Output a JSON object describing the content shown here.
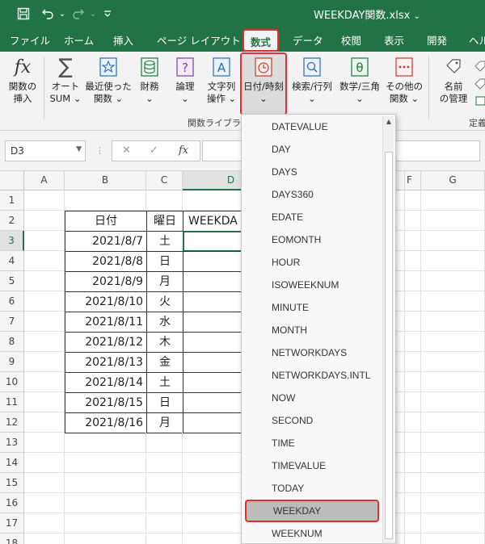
{
  "window": {
    "title": "WEEKDAY関数.xlsx",
    "title_caret": "⌄",
    "icons": {
      "save": "save-icon",
      "undo": "undo-icon",
      "redo": "redo-icon",
      "customize": "customize-icon"
    }
  },
  "tabs": [
    "ファイル",
    "ホーム",
    "挿入",
    "ページ レイアウト",
    "数式",
    "データ",
    "校閲",
    "表示",
    "開発",
    "ヘル"
  ],
  "active_tab": "数式",
  "ribbon": {
    "buttons": [
      {
        "line1": "関数の",
        "line2": "挿入"
      },
      {
        "line1": "オート",
        "line2": "SUM ⌄"
      },
      {
        "line1": "最近使った",
        "line2": "関数 ⌄"
      },
      {
        "line1": "財務",
        "line2": "⌄"
      },
      {
        "line1": "論理",
        "line2": "⌄"
      },
      {
        "line1": "文字列",
        "line2": "操作 ⌄"
      },
      {
        "line1": "日付/時刻",
        "line2": "⌄"
      },
      {
        "line1": "検索/行列",
        "line2": "⌄"
      },
      {
        "line1": "数学/三角",
        "line2": "⌄"
      },
      {
        "line1": "その他の",
        "line2": "関数 ⌄"
      },
      {
        "line1": "名前",
        "line2": "の管理"
      }
    ],
    "fx_glyph": "fx",
    "group_label_library": "関数ライブラリ",
    "group_label_defined": "定義"
  },
  "formula_bar": {
    "name_box": "D3",
    "cancel": "✕",
    "enter": "✓",
    "fx": "fx",
    "value": ""
  },
  "sheet": {
    "columns": [
      "A",
      "B",
      "C",
      "D",
      "E",
      "F",
      "G"
    ],
    "rows": [
      "1",
      "2",
      "3",
      "4",
      "5",
      "6",
      "7",
      "8",
      "9",
      "10",
      "11",
      "12",
      "13",
      "14",
      "15",
      "16",
      "17",
      "18"
    ],
    "header": {
      "b": "日付",
      "c": "曜日",
      "d": "WEEKDA"
    },
    "data": [
      {
        "date": "2021/8/7",
        "day": "土"
      },
      {
        "date": "2021/8/8",
        "day": "日"
      },
      {
        "date": "2021/8/9",
        "day": "月"
      },
      {
        "date": "2021/8/10",
        "day": "火"
      },
      {
        "date": "2021/8/11",
        "day": "水"
      },
      {
        "date": "2021/8/12",
        "day": "木"
      },
      {
        "date": "2021/8/13",
        "day": "金"
      },
      {
        "date": "2021/8/14",
        "day": "土"
      },
      {
        "date": "2021/8/15",
        "day": "日"
      },
      {
        "date": "2021/8/16",
        "day": "月"
      }
    ]
  },
  "dropdown": {
    "items": [
      "DATEVALUE",
      "DAY",
      "DAYS",
      "DAYS360",
      "EDATE",
      "EOMONTH",
      "HOUR",
      "ISOWEEKNUM",
      "MINUTE",
      "MONTH",
      "NETWORKDAYS",
      "NETWORKDAYS.INTL",
      "NOW",
      "SECOND",
      "TIME",
      "TIMEVALUE",
      "TODAY",
      "WEEKDAY",
      "WEEKNUM"
    ],
    "highlighted": "WEEKDAY",
    "scroll_up": "▲"
  },
  "colors": {
    "excel_green": "#217346",
    "highlight_red": "#e03030"
  }
}
